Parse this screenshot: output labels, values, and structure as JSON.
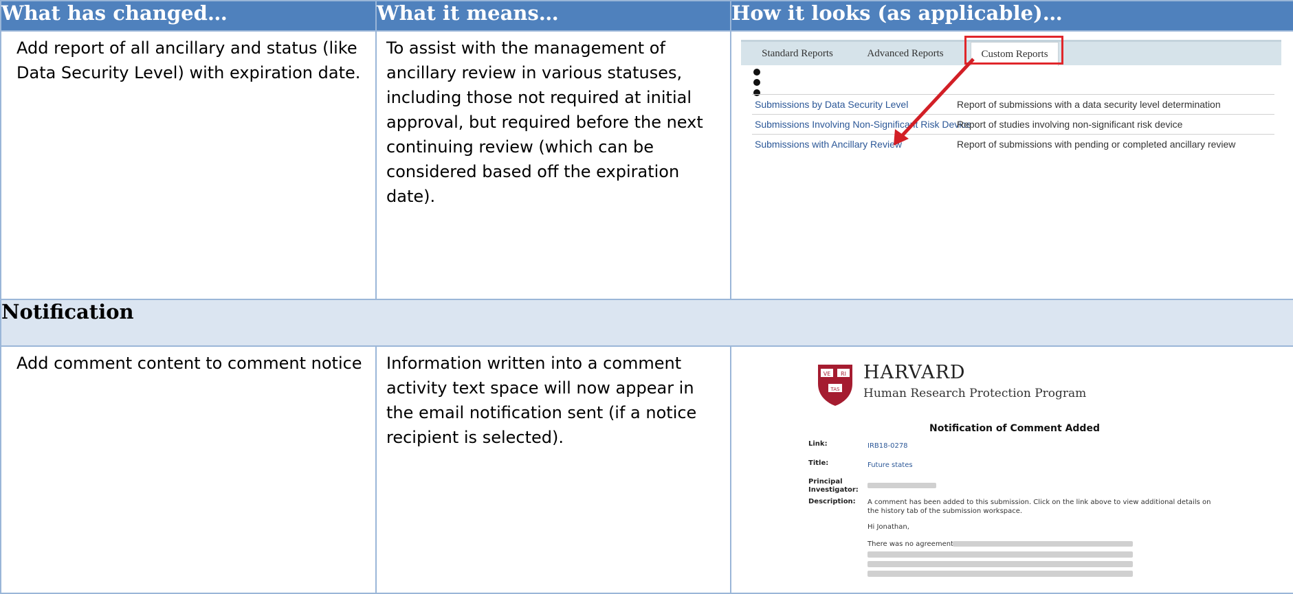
{
  "headers": [
    "What has changed…",
    "What it means…",
    "How it looks (as applicable)…"
  ],
  "row1": {
    "changed": "Add report of all ancillary and status (like Data Security Level) with expiration date.",
    "means": "To assist with the management of ancillary review in various statuses, including those not required at initial approval, but required before the next continuing review (which can be considered based off the expiration date).",
    "screenshot": {
      "tabs": [
        "Standard Reports",
        "Advanced Reports",
        "Custom Reports"
      ],
      "active_tab": "Custom Reports",
      "reports": [
        {
          "name": "Submissions by Data Security Level",
          "desc": "Report of submissions with a data security level determination"
        },
        {
          "name": "Submissions Involving Non-Significant Risk Device",
          "desc": "Report of studies involving non-significant risk device"
        },
        {
          "name": "Submissions with Ancillary Review",
          "desc": "Report of submissions with pending or completed ancillary review"
        }
      ],
      "highlight_color": "#e0262a"
    }
  },
  "section_title": "Notification",
  "row2": {
    "changed": "Add comment content to comment notice",
    "means": "Information written into a comment activity text space will now appear in the email notification sent (if a notice recipient is selected).",
    "email": {
      "org": "HARVARD",
      "program": "Human Research Protection Program",
      "shield_letters": [
        "VE",
        "RI",
        "TAS"
      ],
      "heading": "Notification of Comment Added",
      "link_label": "Link:",
      "link_value": "IRB18-0278",
      "title_label": "Title:",
      "title_value": "Future states",
      "pi_label_1": "Principal",
      "pi_label_2": "Investigator:",
      "desc_label": "Description:",
      "desc_text": "A comment has been added to this submission. Click on the link above to view additional details on the history tab of the submission workspace.",
      "greeting": "Hi Jonathan,",
      "comment_start": "There was no agreement"
    }
  },
  "colors": {
    "header_bg": "#4f81bd",
    "section_bg": "#dbe5f1",
    "border": "#9ab6d8",
    "link": "#2b5797",
    "crimson": "#a51c30"
  }
}
